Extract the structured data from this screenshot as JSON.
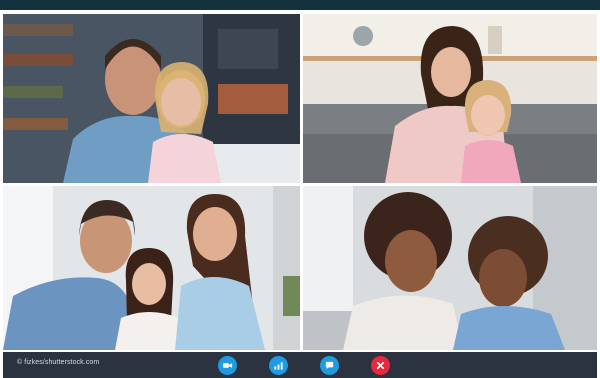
{
  "credit": "© fizkes/shutterstock.com",
  "tiles": [
    {
      "id": "participant-1",
      "label": "Father and daughter on sofa"
    },
    {
      "id": "participant-2",
      "label": "Mother and daughter on sofa"
    },
    {
      "id": "participant-3",
      "label": "Family of three"
    },
    {
      "id": "participant-4",
      "label": "Two girls with curly hair"
    }
  ],
  "controls": [
    {
      "name": "video-button",
      "icon": "video-camera-icon"
    },
    {
      "name": "stats-button",
      "icon": "signal-bars-icon"
    },
    {
      "name": "chat-button",
      "icon": "chat-bubble-icon"
    },
    {
      "name": "end-call-button",
      "icon": "close-icon"
    }
  ],
  "colors": {
    "accent": "#1e9be2",
    "end_call": "#e8283c",
    "bar": "#2b3240",
    "header": "#14313e"
  }
}
